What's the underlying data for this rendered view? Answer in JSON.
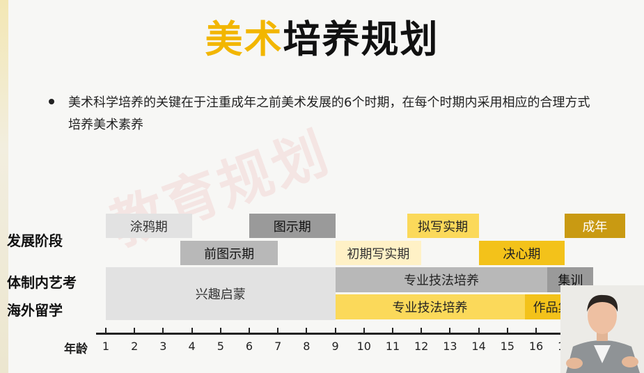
{
  "title": {
    "highlight": "美术",
    "rest": "培养规划"
  },
  "description": "美术科学培养的关键在于注重成年之前美术发展的6个时期，在每个时期内采用相应的合理方式培养美术素养",
  "row_labels": {
    "stage": "发展阶段",
    "domestic": "体制内艺考",
    "overseas": "海外留学"
  },
  "colors": {
    "light_gray": "#e2e2e2",
    "mid_gray": "#b8b8b8",
    "dark_gray": "#9a9a9a",
    "pale_yellow": "#fff1c6",
    "yellow": "#fbd95a",
    "gold": "#f3c21a",
    "olive": "#c99a12"
  },
  "chart_data": {
    "type": "gantt",
    "xlabel": "年龄",
    "x_ticks": [
      1,
      2,
      3,
      4,
      5,
      6,
      7,
      8,
      9,
      10,
      11,
      12,
      13,
      14,
      15,
      16,
      17
    ],
    "xlim": [
      1,
      19
    ],
    "series": [
      {
        "name": "发展阶段",
        "lane": "stage",
        "bars": [
          {
            "label": "涂鸦期",
            "start": 1,
            "end": 4,
            "sub": "upper",
            "fill": "light_gray",
            "text": "#333"
          },
          {
            "label": "前图示期",
            "start": 3.6,
            "end": 7,
            "sub": "lower",
            "fill": "mid_gray",
            "text": "#111"
          },
          {
            "label": "图示期",
            "start": 6,
            "end": 9,
            "sub": "upper",
            "fill": "dark_gray",
            "text": "#111"
          },
          {
            "label": "初期写实期",
            "start": 9,
            "end": 12,
            "sub": "lower",
            "fill": "pale_yellow",
            "text": "#333"
          },
          {
            "label": "拟写实期",
            "start": 11.5,
            "end": 14,
            "sub": "upper",
            "fill": "yellow",
            "text": "#222"
          },
          {
            "label": "决心期",
            "start": 14,
            "end": 17,
            "sub": "lower",
            "fill": "gold",
            "text": "#222"
          },
          {
            "label": "成年",
            "start": 17,
            "end": 19.1,
            "sub": "upper",
            "fill": "olive",
            "text": "#fff"
          }
        ]
      },
      {
        "name": "体制内艺考",
        "lane": "domestic",
        "bars": [
          {
            "label": "兴趣启蒙",
            "start": 1,
            "end": 9,
            "sub": "span",
            "fill": "light_gray",
            "text": "#333"
          },
          {
            "label": "专业技法培养",
            "start": 9,
            "end": 16.4,
            "sub": "full",
            "fill": "mid_gray",
            "text": "#222"
          },
          {
            "label": "集训",
            "start": 16.4,
            "end": 18,
            "sub": "full",
            "fill": "dark_gray",
            "text": "#111"
          }
        ]
      },
      {
        "name": "海外留学",
        "lane": "overseas",
        "bars": [
          {
            "label": "专业技法培养",
            "start": 9,
            "end": 15.6,
            "sub": "full",
            "fill": "yellow",
            "text": "#222"
          },
          {
            "label": "作品集",
            "start": 15.6,
            "end": 17.5,
            "sub": "full",
            "fill": "gold",
            "text": "#222"
          }
        ]
      }
    ]
  }
}
